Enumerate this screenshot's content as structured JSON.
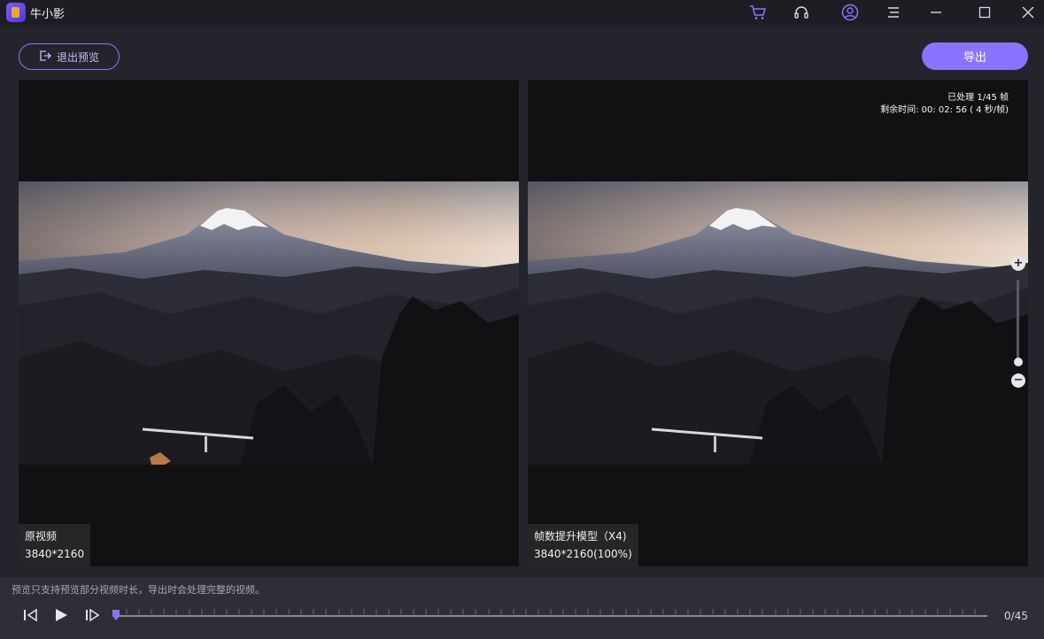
{
  "app": {
    "title": "牛小影"
  },
  "titlebar": {
    "icons": [
      "cart-icon",
      "headset-icon",
      "user-icon",
      "menu-icon",
      "minimize-icon",
      "maximize-icon",
      "close-icon"
    ]
  },
  "toolbar": {
    "exit_label": "退出预览",
    "export_label": "导出"
  },
  "left_pane": {
    "caption_title": "原视频",
    "caption_resolution": "3840*2160"
  },
  "right_pane": {
    "status_processed": "已处理 1/45 帧",
    "status_remaining": "剩余时间: 00: 02: 56 ( 4 秒/帧)",
    "caption_title": "帧数提升模型（X4)",
    "caption_resolution": "3840*2160(100%)"
  },
  "zoom": {
    "plus": "+",
    "minus": "−",
    "level": 0.05
  },
  "footer": {
    "note": "预览只支持预览部分视频时长，导出时会处理完整的视频。",
    "frame_counter": "0/45",
    "progress": 0
  },
  "colors": {
    "accent": "#8a74ff",
    "background": "#24242c",
    "pane": "#111113"
  }
}
